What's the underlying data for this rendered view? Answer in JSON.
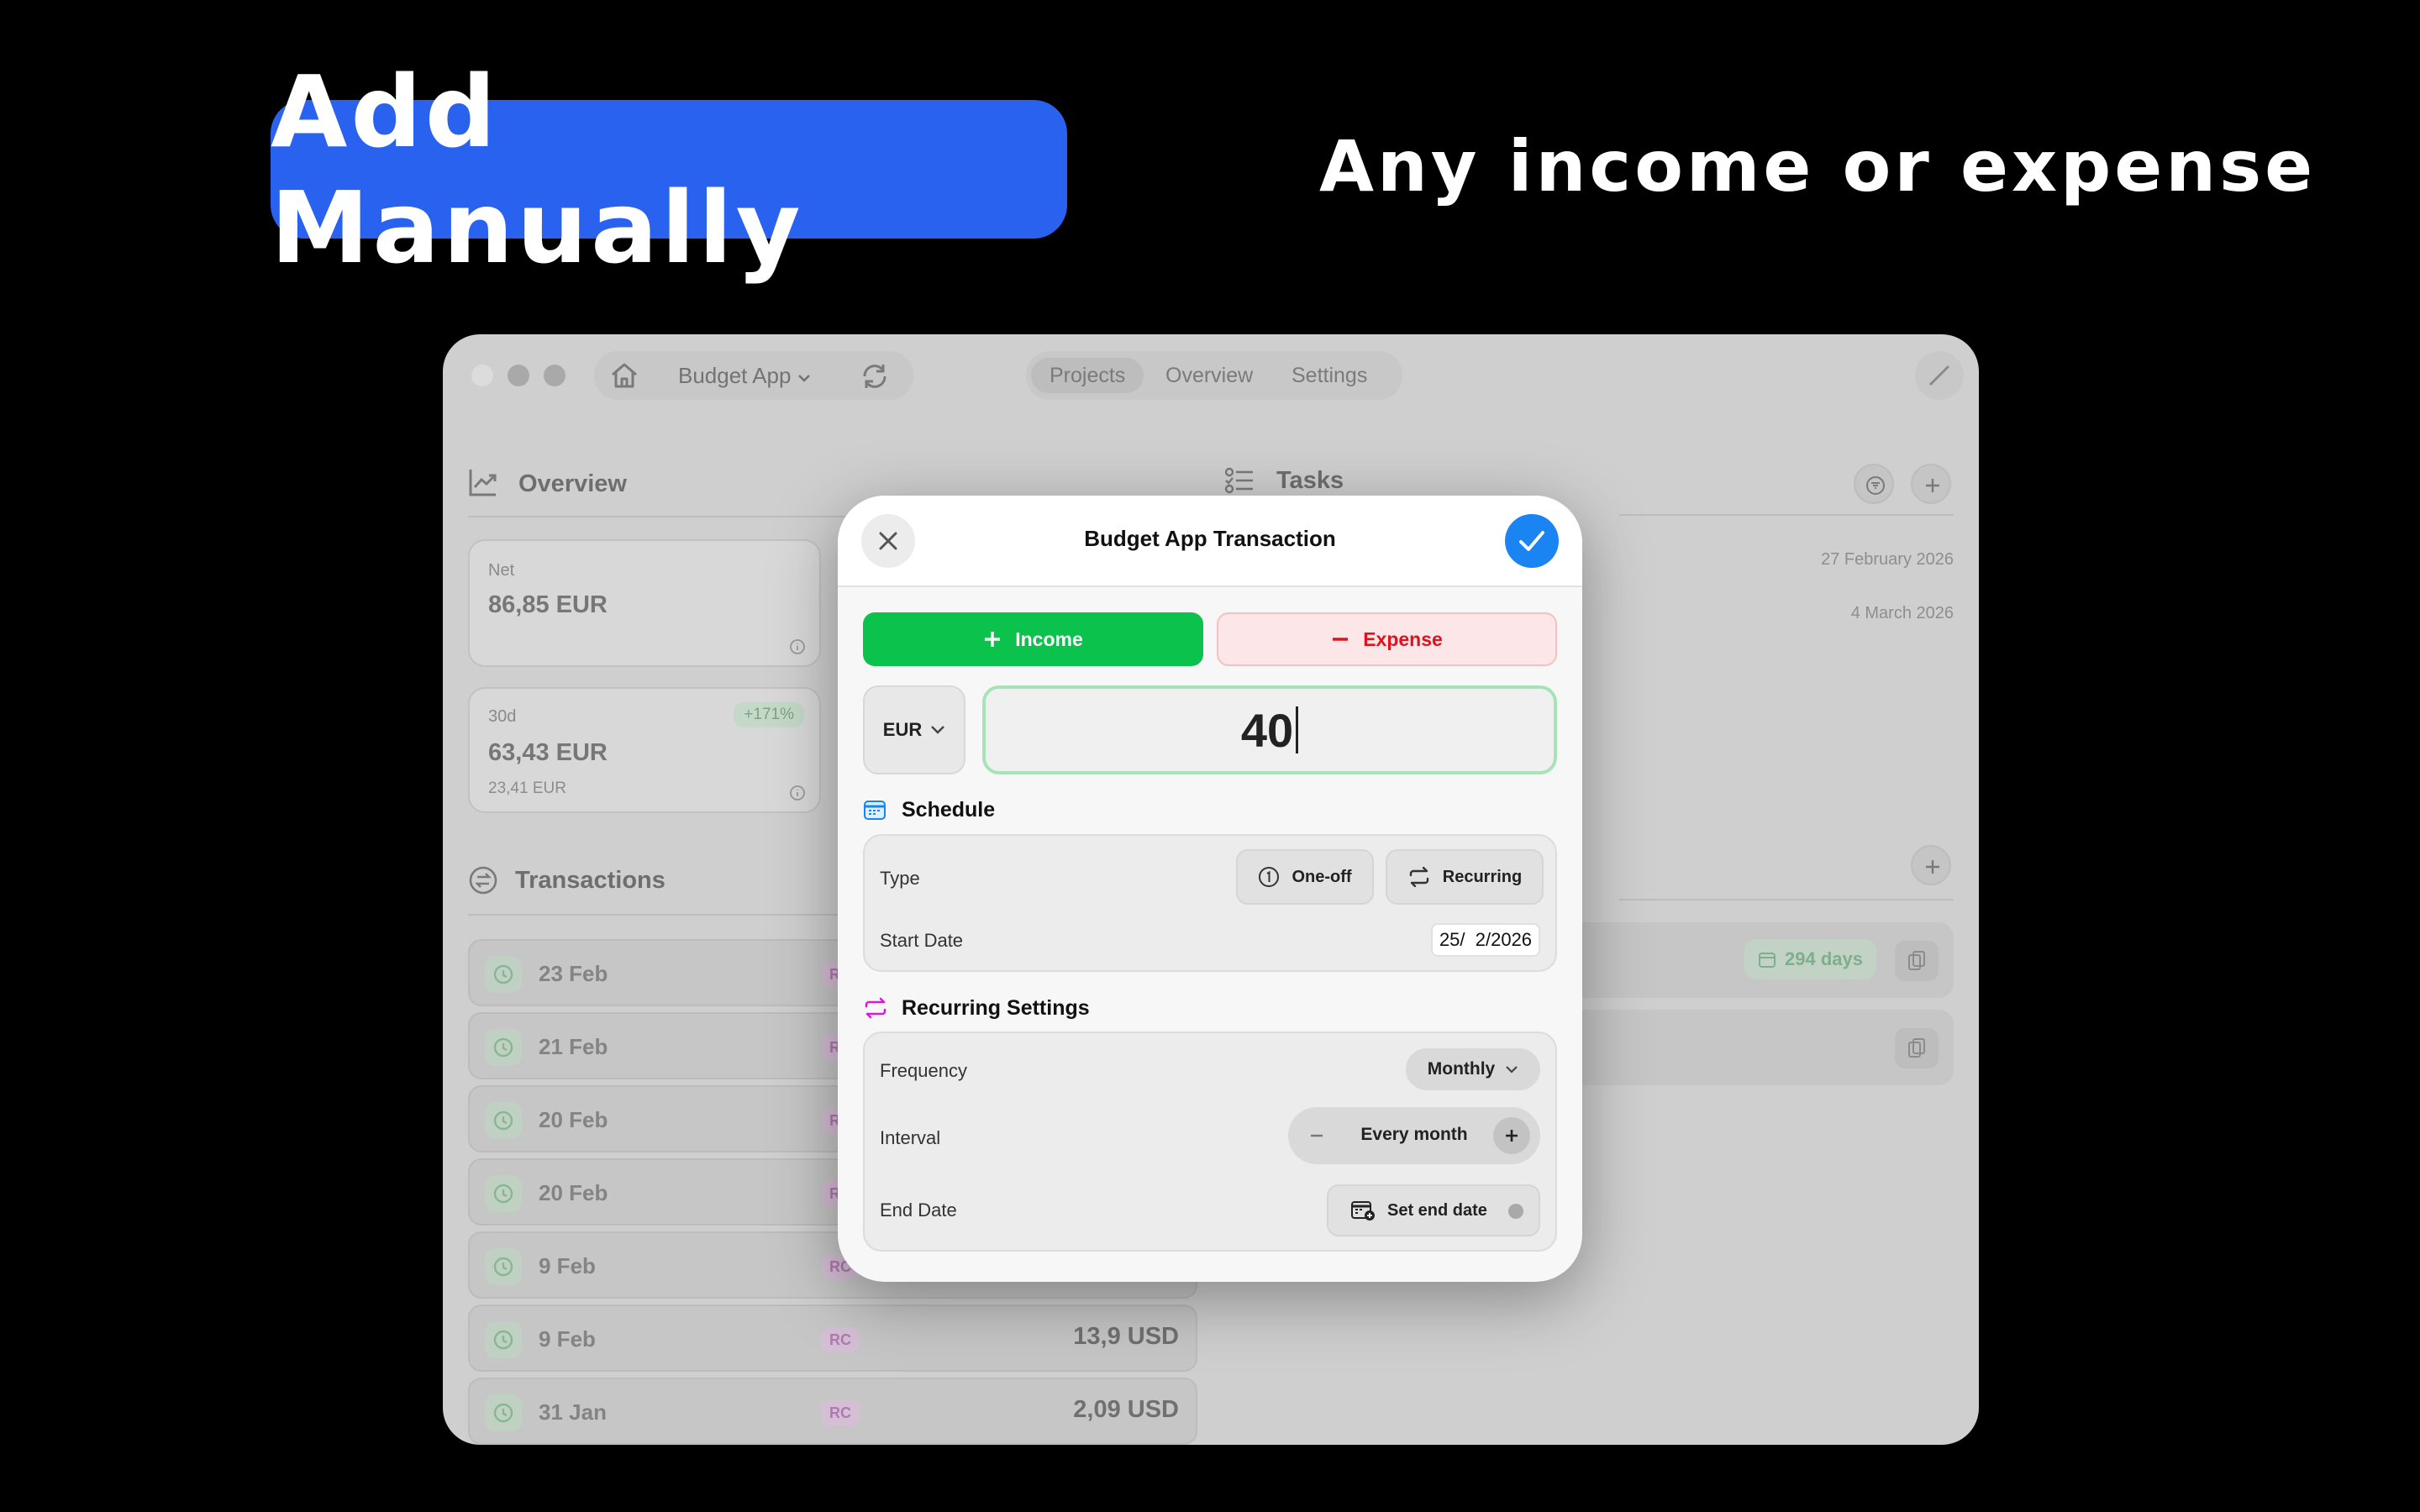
{
  "marketing": {
    "headline": "Add Manually",
    "tagline": "Any income or expense"
  },
  "app": {
    "project_name": "Budget App",
    "tabs": [
      "Projects",
      "Overview",
      "Settings"
    ],
    "overview": {
      "title": "Overview",
      "net_label": "Net",
      "net_value": "86,85 EUR",
      "period_label": "30d",
      "period_value": "63,43 EUR",
      "period_sub": "23,41 EUR",
      "trend": "+171%"
    },
    "transactions": {
      "title": "Transactions",
      "rows": [
        {
          "date": "23 Feb",
          "tag": "RC",
          "amount": ""
        },
        {
          "date": "21 Feb",
          "tag": "RC",
          "amount": ""
        },
        {
          "date": "20 Feb",
          "tag": "RC",
          "amount": ""
        },
        {
          "date": "20 Feb",
          "tag": "RC",
          "amount": ""
        },
        {
          "date": "9 Feb",
          "tag": "RC",
          "amount": ""
        },
        {
          "date": "9 Feb",
          "tag": "RC",
          "amount": "13,9 USD"
        },
        {
          "date": "31 Jan",
          "tag": "RC",
          "amount": "2,09 USD"
        }
      ]
    },
    "tasks": {
      "title": "Tasks",
      "dates": [
        "27 February 2026",
        "4 March 2026"
      ]
    },
    "project_row": {
      "days_badge": "294 days"
    }
  },
  "modal": {
    "title": "Budget App Transaction",
    "income_label": "Income",
    "expense_label": "Expense",
    "currency": "EUR",
    "amount": "40",
    "schedule": {
      "title": "Schedule",
      "type_label": "Type",
      "one_off_label": "One-off",
      "recurring_label": "Recurring",
      "start_date_label": "Start Date",
      "start_date_value": "25/  2/2026"
    },
    "recurring": {
      "title": "Recurring Settings",
      "frequency_label": "Frequency",
      "frequency_value": "Monthly",
      "interval_label": "Interval",
      "interval_value": "Every month",
      "end_date_label": "End Date",
      "end_date_button": "Set end date"
    }
  },
  "colors": {
    "headline_pill": "#2a62f0",
    "income_green": "#0ac24c",
    "expense_red": "#e0121d",
    "confirm_blue": "#1a84f3",
    "recurring_magenta": "#d81ad8"
  }
}
